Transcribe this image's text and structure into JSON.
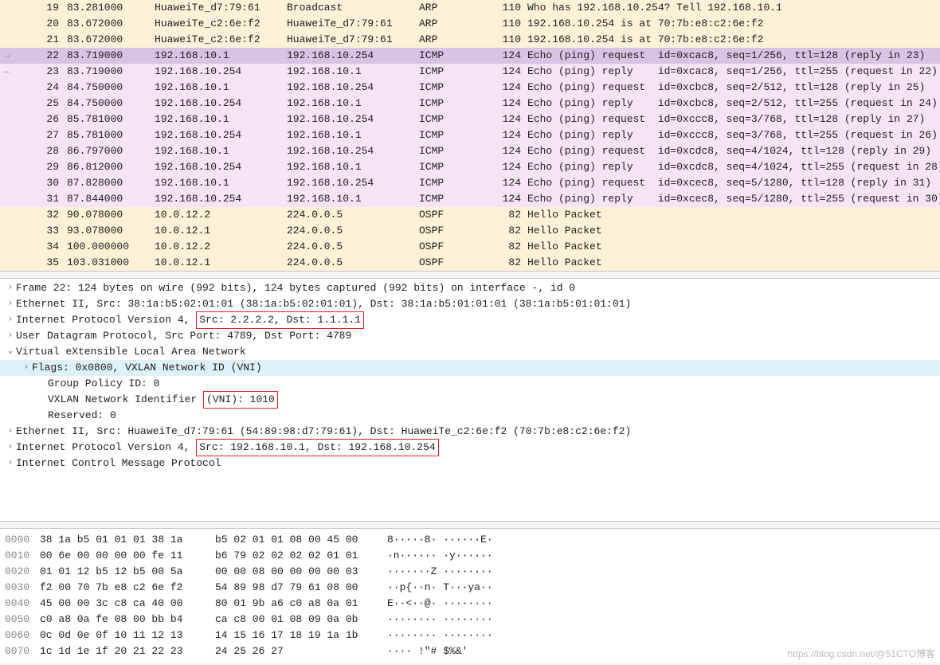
{
  "packets": [
    {
      "arrow": "",
      "no": "19",
      "time": "83.281000",
      "src": "HuaweiTe_d7:79:61",
      "dst": "Broadcast",
      "prot": "ARP",
      "len": "110",
      "info": "Who has 192.168.10.254? Tell 192.168.10.1",
      "cls": "row-arp"
    },
    {
      "arrow": "",
      "no": "20",
      "time": "83.672000",
      "src": "HuaweiTe_c2:6e:f2",
      "dst": "HuaweiTe_d7:79:61",
      "prot": "ARP",
      "len": "110",
      "info": "192.168.10.254 is at 70:7b:e8:c2:6e:f2",
      "cls": "row-arp"
    },
    {
      "arrow": "",
      "no": "21",
      "time": "83.672000",
      "src": "HuaweiTe_c2:6e:f2",
      "dst": "HuaweiTe_d7:79:61",
      "prot": "ARP",
      "len": "110",
      "info": "192.168.10.254 is at 70:7b:e8:c2:6e:f2",
      "cls": "row-arp"
    },
    {
      "arrow": "→",
      "no": "22",
      "time": "83.719000",
      "src": "192.168.10.1",
      "dst": "192.168.10.254",
      "prot": "ICMP",
      "len": "124",
      "info": "Echo (ping) request  id=0xcac8, seq=1/256, ttl=128 (reply in 23)",
      "cls": "row-sel"
    },
    {
      "arrow": "←",
      "no": "23",
      "time": "83.719000",
      "src": "192.168.10.254",
      "dst": "192.168.10.1",
      "prot": "ICMP",
      "len": "124",
      "info": "Echo (ping) reply    id=0xcac8, seq=1/256, ttl=255 (request in 22)",
      "cls": "row-icmp"
    },
    {
      "arrow": "",
      "no": "24",
      "time": "84.750000",
      "src": "192.168.10.1",
      "dst": "192.168.10.254",
      "prot": "ICMP",
      "len": "124",
      "info": "Echo (ping) request  id=0xcbc8, seq=2/512, ttl=128 (reply in 25)",
      "cls": "row-icmp"
    },
    {
      "arrow": "",
      "no": "25",
      "time": "84.750000",
      "src": "192.168.10.254",
      "dst": "192.168.10.1",
      "prot": "ICMP",
      "len": "124",
      "info": "Echo (ping) reply    id=0xcbc8, seq=2/512, ttl=255 (request in 24)",
      "cls": "row-icmp"
    },
    {
      "arrow": "",
      "no": "26",
      "time": "85.781000",
      "src": "192.168.10.1",
      "dst": "192.168.10.254",
      "prot": "ICMP",
      "len": "124",
      "info": "Echo (ping) request  id=0xccc8, seq=3/768, ttl=128 (reply in 27)",
      "cls": "row-icmp"
    },
    {
      "arrow": "",
      "no": "27",
      "time": "85.781000",
      "src": "192.168.10.254",
      "dst": "192.168.10.1",
      "prot": "ICMP",
      "len": "124",
      "info": "Echo (ping) reply    id=0xccc8, seq=3/768, ttl=255 (request in 26)",
      "cls": "row-icmp"
    },
    {
      "arrow": "",
      "no": "28",
      "time": "86.797000",
      "src": "192.168.10.1",
      "dst": "192.168.10.254",
      "prot": "ICMP",
      "len": "124",
      "info": "Echo (ping) request  id=0xcdc8, seq=4/1024, ttl=128 (reply in 29)",
      "cls": "row-icmp"
    },
    {
      "arrow": "",
      "no": "29",
      "time": "86.812000",
      "src": "192.168.10.254",
      "dst": "192.168.10.1",
      "prot": "ICMP",
      "len": "124",
      "info": "Echo (ping) reply    id=0xcdc8, seq=4/1024, ttl=255 (request in 28)",
      "cls": "row-icmp"
    },
    {
      "arrow": "",
      "no": "30",
      "time": "87.828000",
      "src": "192.168.10.1",
      "dst": "192.168.10.254",
      "prot": "ICMP",
      "len": "124",
      "info": "Echo (ping) request  id=0xcec8, seq=5/1280, ttl=128 (reply in 31)",
      "cls": "row-icmp"
    },
    {
      "arrow": "",
      "no": "31",
      "time": "87.844000",
      "src": "192.168.10.254",
      "dst": "192.168.10.1",
      "prot": "ICMP",
      "len": "124",
      "info": "Echo (ping) reply    id=0xcec8, seq=5/1280, ttl=255 (request in 30)",
      "cls": "row-icmp"
    },
    {
      "arrow": "",
      "no": "32",
      "time": "90.078000",
      "src": "10.0.12.2",
      "dst": "224.0.0.5",
      "prot": "OSPF",
      "len": "82",
      "info": "Hello Packet",
      "cls": "row-ospf"
    },
    {
      "arrow": "",
      "no": "33",
      "time": "93.078000",
      "src": "10.0.12.1",
      "dst": "224.0.0.5",
      "prot": "OSPF",
      "len": "82",
      "info": "Hello Packet",
      "cls": "row-ospf"
    },
    {
      "arrow": "",
      "no": "34",
      "time": "100.000000",
      "src": "10.0.12.2",
      "dst": "224.0.0.5",
      "prot": "OSPF",
      "len": "82",
      "info": "Hello Packet",
      "cls": "row-ospf"
    },
    {
      "arrow": "",
      "no": "35",
      "time": "103.031000",
      "src": "10.0.12.1",
      "dst": "224.0.0.5",
      "prot": "OSPF",
      "len": "82",
      "info": "Hello Packet",
      "cls": "row-ospf"
    }
  ],
  "details": {
    "frame": "Frame 22: 124 bytes on wire (992 bits), 124 bytes captured (992 bits) on interface -, id 0",
    "eth": "Ethernet II, Src: 38:1a:b5:02:01:01 (38:1a:b5:02:01:01), Dst: 38:1a:b5:01:01:01 (38:1a:b5:01:01:01)",
    "ip_pre": "Internet Protocol Version 4, ",
    "ip_box": "Src: 2.2.2.2, Dst: 1.1.1.1",
    "udp": "User Datagram Protocol, Src Port: 4789, Dst Port: 4789",
    "vxlan": "Virtual eXtensible Local Area Network",
    "flags": "Flags: 0x0800, VXLAN Network ID (VNI)",
    "gpid": "Group Policy ID: 0",
    "vni_pre": "VXLAN Network Identifier ",
    "vni_box": "(VNI): 1010",
    "res": "Reserved: 0",
    "eth2": "Ethernet II, Src: HuaweiTe_d7:79:61 (54:89:98:d7:79:61), Dst: HuaweiTe_c2:6e:f2 (70:7b:e8:c2:6e:f2)",
    "ip2_pre": "Internet Protocol Version 4, ",
    "ip2_box": "Src: 192.168.10.1, Dst: 192.168.10.254",
    "icmp": "Internet Control Message Protocol"
  },
  "bytes": [
    {
      "off": "0000",
      "h1": "38 1a b5 01 01 01 38 1a",
      "h2": "b5 02 01 01 08 00 45 00",
      "a": "8·····8· ······E·"
    },
    {
      "off": "0010",
      "h1": "00 6e 00 00 00 00 fe 11",
      "h2": "b6 79 02 02 02 02 01 01",
      "a": "·n······ ·y······"
    },
    {
      "off": "0020",
      "h1": "01 01 12 b5 12 b5 00 5a",
      "h2": "00 00 08 00 00 00 00 03",
      "a": "·······Z ········"
    },
    {
      "off": "0030",
      "h1": "f2 00 70 7b e8 c2 6e f2",
      "h2": "54 89 98 d7 79 61 08 00",
      "a": "··p{··n· T···ya··"
    },
    {
      "off": "0040",
      "h1": "45 00 00 3c c8 ca 40 00",
      "h2": "80 01 9b a6 c0 a8 0a 01",
      "a": "E··<··@· ········"
    },
    {
      "off": "0050",
      "h1": "c0 a8 0a fe 08 00 bb b4",
      "h2": "ca c8 00 01 08 09 0a 0b",
      "a": "········ ········"
    },
    {
      "off": "0060",
      "h1": "0c 0d 0e 0f 10 11 12 13",
      "h2": "14 15 16 17 18 19 1a 1b",
      "a": "········ ········"
    },
    {
      "off": "0070",
      "h1": "1c 1d 1e 1f 20 21 22 23",
      "h2": "24 25 26 27",
      "a": "···· !\"# $%&'"
    }
  ],
  "watermark": "https://blog.csdn.net/@51CTO博客"
}
